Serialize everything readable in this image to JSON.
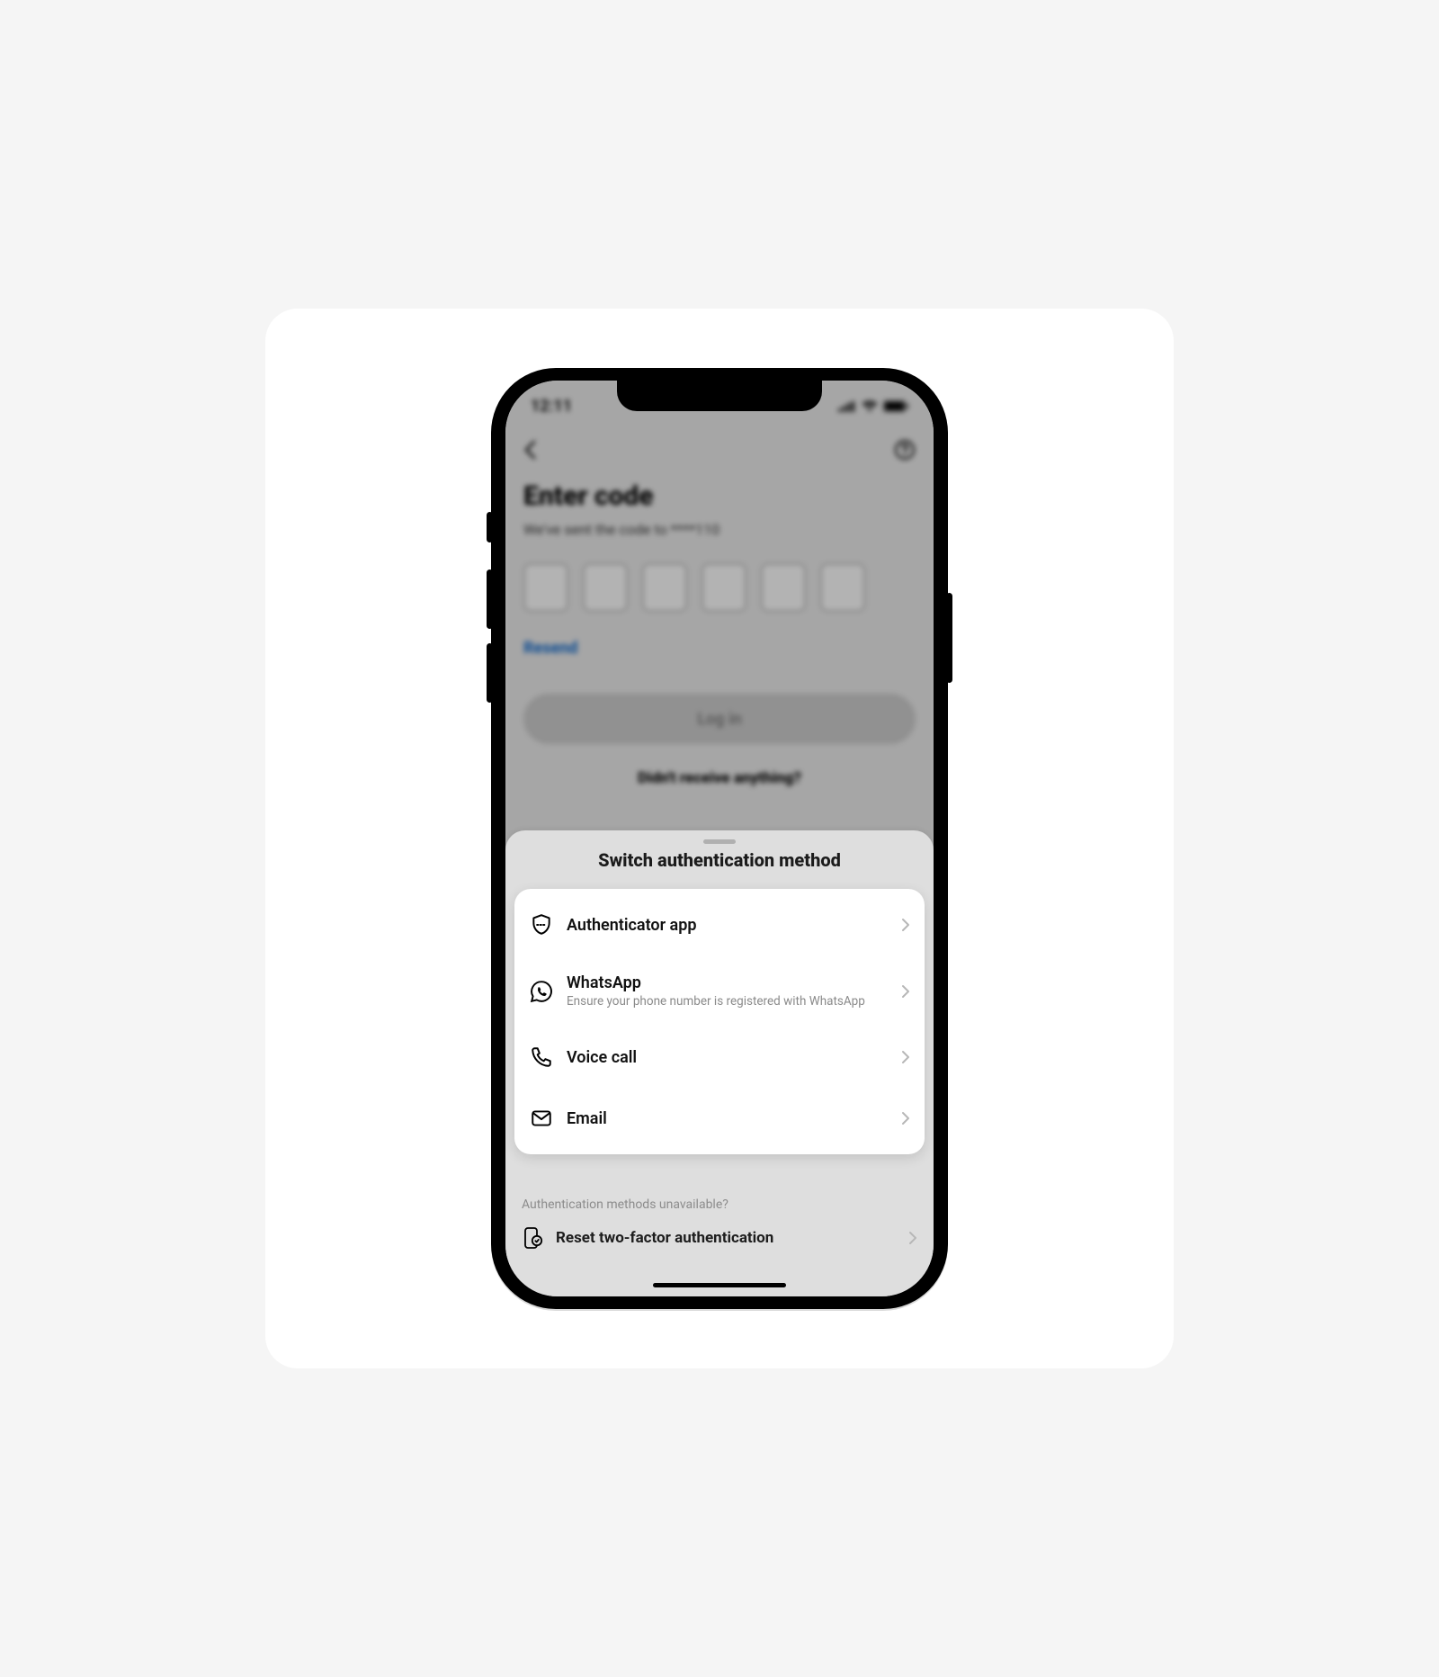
{
  "status": {
    "time": "12:11"
  },
  "page": {
    "title": "Enter code",
    "subtitle": "We've sent the code to ****110",
    "resend": "Resend",
    "login": "Log in",
    "didnt": "Didn't receive anything?"
  },
  "sheet": {
    "title": "Switch authentication method",
    "methods": [
      {
        "label": "Authenticator app",
        "sub": ""
      },
      {
        "label": "WhatsApp",
        "sub": "Ensure your phone number is registered with WhatsApp"
      },
      {
        "label": "Voice call",
        "sub": ""
      },
      {
        "label": "Email",
        "sub": ""
      }
    ],
    "unavailable": "Authentication methods unavailable?",
    "reset": "Reset two-factor authentication"
  }
}
